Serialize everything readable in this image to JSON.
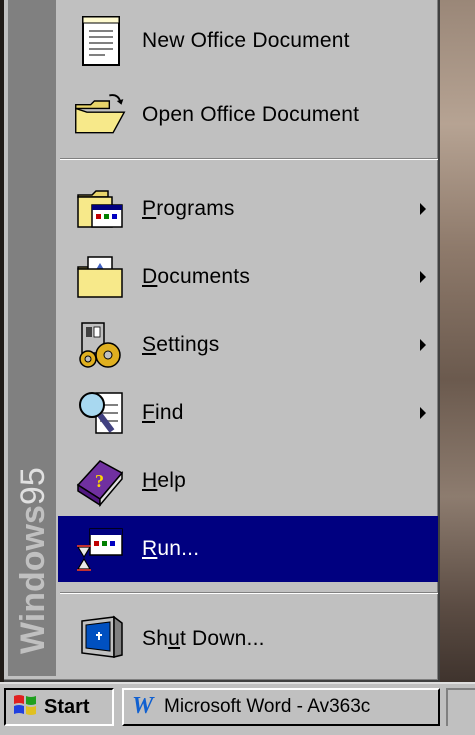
{
  "start_menu": {
    "brand": "Windows95",
    "items": [
      {
        "label": "New Office Document",
        "icon": "new-document-icon",
        "submenu": false
      },
      {
        "label": "Open Office Document",
        "icon": "open-folder-icon",
        "submenu": false
      },
      {
        "label": "Programs",
        "icon": "programs-folder-icon",
        "submenu": true,
        "mnemonic": "P"
      },
      {
        "label": "Documents",
        "icon": "documents-folder-icon",
        "submenu": true,
        "mnemonic": "D"
      },
      {
        "label": "Settings",
        "icon": "settings-icon",
        "submenu": true,
        "mnemonic": "S"
      },
      {
        "label": "Find",
        "icon": "find-magnifier-icon",
        "submenu": true,
        "mnemonic": "F"
      },
      {
        "label": "Help",
        "icon": "help-book-icon",
        "submenu": false,
        "mnemonic": "H"
      },
      {
        "label": "Run...",
        "icon": "run-icon",
        "submenu": false,
        "mnemonic": "R",
        "selected": true
      },
      {
        "label": "Shut Down...",
        "icon": "shutdown-monitor-icon",
        "submenu": false,
        "mnemonic": "u"
      }
    ]
  },
  "taskbar": {
    "start_label": "Start",
    "task_label": "Microsoft Word - Av363c",
    "task_icon": "word-w-icon"
  },
  "colors": {
    "face": "#c0c0c0",
    "selection": "#000080",
    "brand_bar": "#808080"
  }
}
